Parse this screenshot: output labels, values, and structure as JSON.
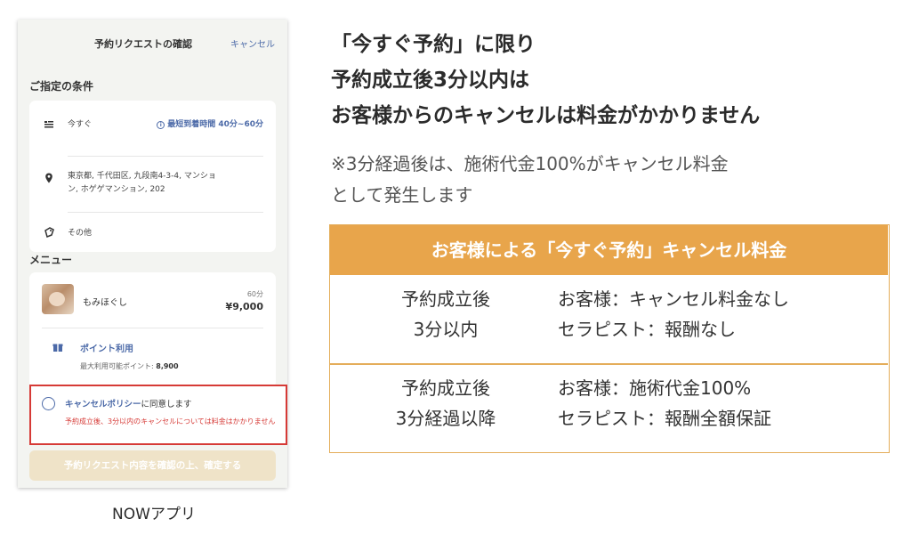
{
  "app": {
    "header": {
      "title": "予約リクエストの確認",
      "cancel_label": "キャンセル"
    },
    "conditions": {
      "section_label": "ご指定の条件",
      "timing_label": "今すぐ",
      "eta_label": "最短到着時間 40分~60分",
      "address_line1": "東京都, 千代田区, 九段南4-3-4, マンショ",
      "address_line2": "ン, ホゲゲマンション, 202",
      "other_label": "その他"
    },
    "menu": {
      "section_label": "メニュー",
      "item_name": "もみほぐし",
      "item_duration": "60分",
      "item_price": "¥9,000",
      "points_label": "ポイント利用",
      "points_sub_prefix": "最大利用可能ポイント:",
      "points_value": "8,900"
    },
    "policy": {
      "title_link": "キャンセルポリシー",
      "title_rest": "に同意します",
      "note": "予約成立後、3分以内のキャンセルについては料金はかかりません"
    },
    "confirm_button": "予約リクエスト内容を確認の上、確定する",
    "caption": "NOWアプリ"
  },
  "headline": {
    "line1": "「今すぐ予約」に限り",
    "line2": "予約成立後3分以内は",
    "line3": "お客様からのキャンセルは料金がかかりません"
  },
  "note": {
    "line1": "※3分経過後は、施術代金100%がキャンセル料金",
    "line2": "として発生します"
  },
  "fee_table": {
    "header": "お客様による「今すぐ予約」キャンセル料金",
    "rows": [
      {
        "cond1": "予約成立後",
        "cond2": "3分以内",
        "res1": "お客様：キャンセル料金なし",
        "res2": "セラピスト：報酬なし"
      },
      {
        "cond1": "予約成立後",
        "cond2": "3分経過以降",
        "res1": "お客様：施術代金100%",
        "res2": "セラピスト：報酬全額保証"
      }
    ]
  },
  "colors": {
    "accent_blue": "#4c6aa8",
    "alert_red": "#d63a36",
    "table_orange": "#e8a54b",
    "button_beige": "#efe3c8"
  },
  "icons": [
    "cart-icon",
    "location-pin-icon",
    "tag-icon",
    "info-icon",
    "gift-icon",
    "radio-unchecked-icon"
  ]
}
